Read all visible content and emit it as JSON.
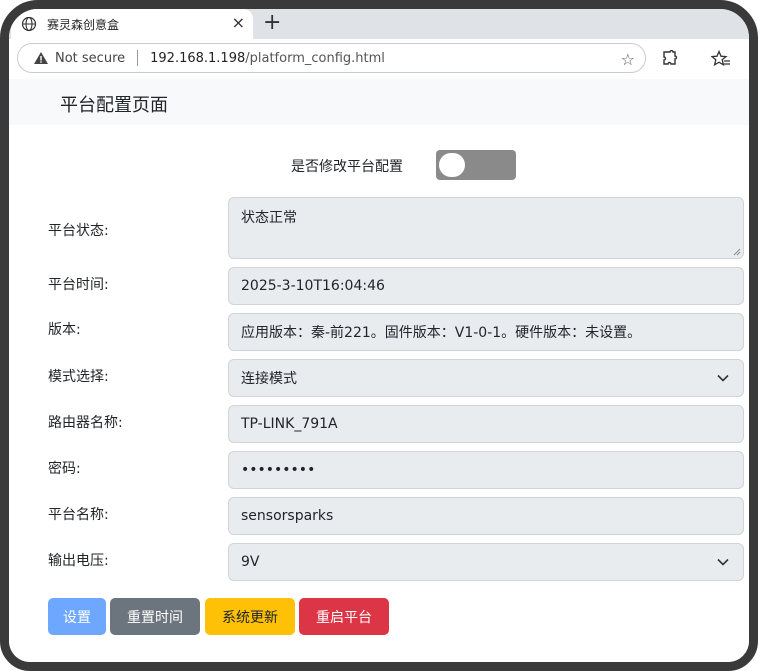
{
  "browser": {
    "tab_title": "赛灵森创意盒",
    "tab_close": "×",
    "new_tab": "+",
    "security_label": "Not secure",
    "url_host": "192.168.1.198",
    "url_path": "/platform_config.html",
    "star": "☆"
  },
  "page": {
    "title": "平台配置页面",
    "toggle_label": "是否修改平台配置",
    "toggle_on": false
  },
  "form": {
    "status_label": "平台状态:",
    "status_value": "状态正常",
    "time_label": "平台时间:",
    "time_value": "2025-3-10T16:04:46",
    "version_label": "版本:",
    "version_value": "应用版本：秦-前221。固件版本：V1-0-1。硬件版本：未设置。",
    "mode_label": "模式选择:",
    "mode_value": "连接模式",
    "router_label": "路由器名称:",
    "router_value": "TP-LINK_791A",
    "password_label": "密码:",
    "password_value": "•••••••••",
    "platform_name_label": "平台名称:",
    "platform_name_value": "sensorsparks",
    "voltage_label": "输出电压:",
    "voltage_value": "9V"
  },
  "buttons": {
    "set": "设置",
    "reset_time": "重置时间",
    "update": "系统更新",
    "restart": "重启平台"
  },
  "colors": {
    "set": "#6ea8fe",
    "reset_time": "#6c757d",
    "update": "#ffc107",
    "restart": "#dc3545",
    "toggle_off": "#8a8a8a"
  }
}
